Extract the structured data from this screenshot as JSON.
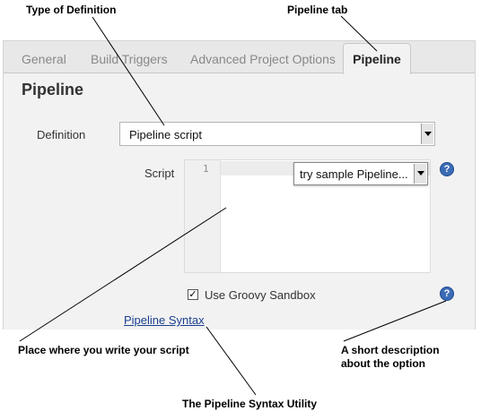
{
  "annotations": {
    "type_of_definition": "Type of Definition",
    "pipeline_tab": "Pipeline tab",
    "write_script": "Place where you write your script",
    "short_description": [
      "A short description",
      "about the option"
    ],
    "syntax_utility": "The Pipeline Syntax Utility"
  },
  "tabs": {
    "general": "General",
    "build_triggers": "Build Triggers",
    "advanced_options": "Advanced Project Options",
    "pipeline": "Pipeline"
  },
  "section_title": "Pipeline",
  "definition": {
    "label": "Definition",
    "selected": "Pipeline script"
  },
  "script": {
    "label": "Script",
    "line_number": "1",
    "sample_selected": "try sample Pipeline..."
  },
  "sandbox": {
    "label": "Use Groovy Sandbox",
    "checked": true
  },
  "syntax_link": "Pipeline Syntax",
  "icons": [
    "help-icon",
    "checkbox-checked-icon",
    "dropdown-arrow-icon"
  ]
}
